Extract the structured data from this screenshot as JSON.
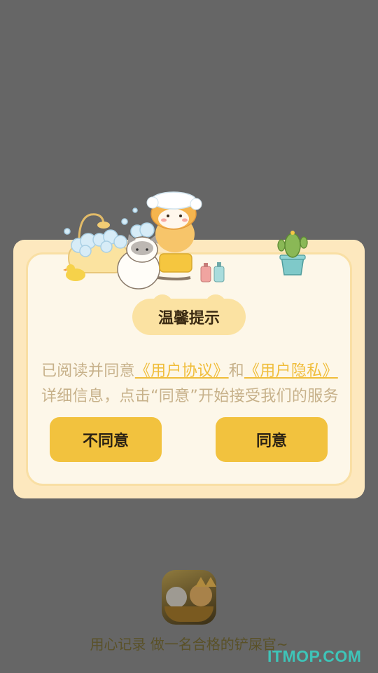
{
  "splash": {
    "slogan": "用心记录 做一名合格的铲屎官~",
    "watermark": "ITMOP.COM"
  },
  "dialog": {
    "title": "温馨提示",
    "message_prefix": "已阅读并同意",
    "user_agreement_link": "《用户协议》",
    "conjunction": "和",
    "privacy_link": "《用户隐私》",
    "message_suffix": "详细信息，点击“同意”开始接受我们的服务",
    "decline_label": "不同意",
    "accept_label": "同意"
  },
  "colors": {
    "overlay": "#666666",
    "dialog_bg": "#fde8be",
    "dialog_inner": "#fdf7e9",
    "button": "#f2c23e",
    "link": "#f0bd3a",
    "body_text": "#c7b18a"
  },
  "icons": [
    "app-icon",
    "bathtub-illustration",
    "cactus-illustration"
  ]
}
